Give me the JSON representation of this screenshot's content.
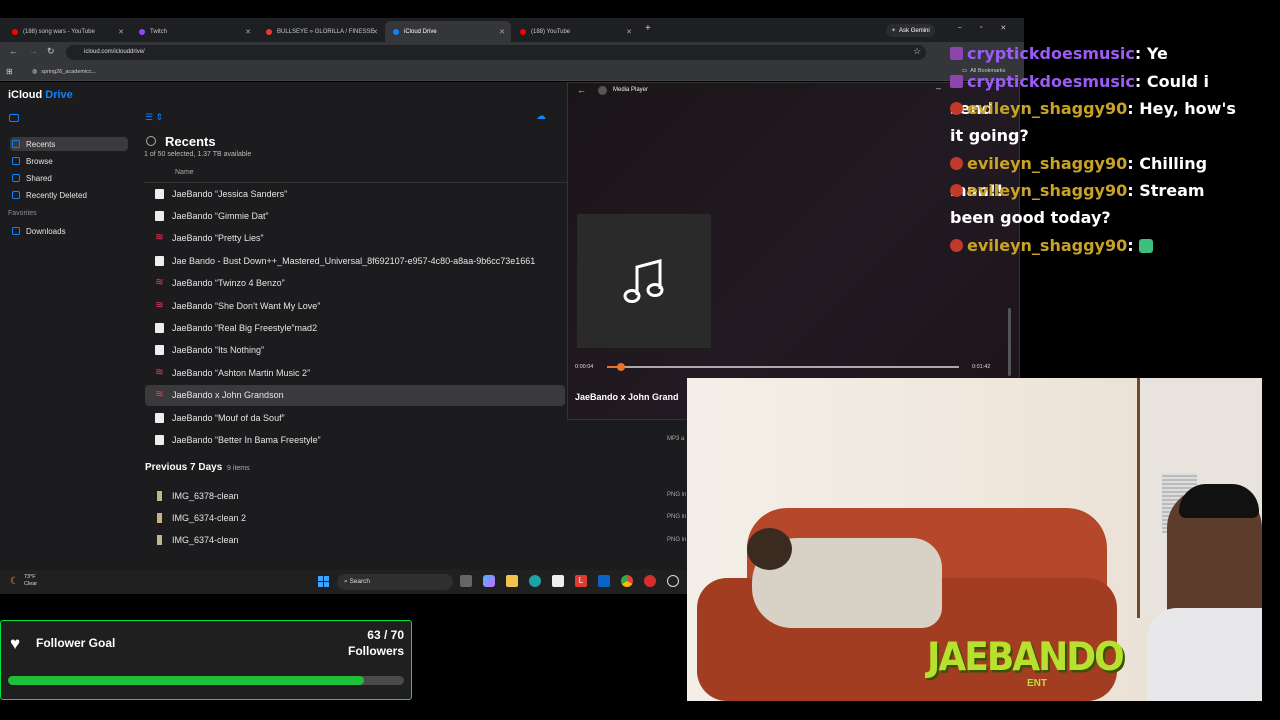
{
  "browser": {
    "tabs": [
      {
        "title": "(188) song wars - YouTube",
        "icon_color": "#ff0000",
        "active": false
      },
      {
        "title": "Twitch",
        "icon_color": "#9146ff",
        "active": false
      },
      {
        "title": "BULLSEYE » GLORILLA / FINESSE",
        "icon_color": "#e53935",
        "active": false
      },
      {
        "title": "iCloud Drive",
        "icon_color": "#0a84ff",
        "active": true
      },
      {
        "title": "(188) YouTube",
        "icon_color": "#ff0000",
        "active": false
      }
    ],
    "ask_gemini": "Ask Gemini",
    "url": "icloud.com/iclouddrive/",
    "bookmark": "spring26_academicc...",
    "all_bookmarks": "All Bookmarks"
  },
  "icloud": {
    "brand": "iCloud",
    "product": "Drive",
    "sidebar": [
      {
        "label": "Recents",
        "selected": true
      },
      {
        "label": "Browse",
        "selected": false
      },
      {
        "label": "Shared",
        "selected": false
      },
      {
        "label": "Recently Deleted",
        "selected": false
      }
    ],
    "favorites_label": "Favorites",
    "favorites": [
      {
        "label": "Downloads"
      }
    ],
    "title": "Recents",
    "subtitle": "1 of 50 selected, 1.37 TB available",
    "name_header": "Name",
    "files": [
      {
        "name": "JaeBando “Jessica Sanders”",
        "type": "doc"
      },
      {
        "name": "JaeBando “Gimmie Dat”",
        "type": "doc"
      },
      {
        "name": "JaeBando “Pretty Lies”",
        "type": "audio"
      },
      {
        "name": "Jae Bando - Bust Down++_Mastered_Universal_8f692107-e957-4c80-a8aa-9b6cc73e1661",
        "type": "doc"
      },
      {
        "name": "JaeBando “Twinzo 4 Benzo”",
        "type": "audio"
      },
      {
        "name": "JaeBando “She Don’t Want My Love”",
        "type": "audio"
      },
      {
        "name": "JaeBando “Real Big Freestyle”mad2",
        "type": "doc"
      },
      {
        "name": "JaeBando “Its Nothing”",
        "type": "doc"
      },
      {
        "name": "JaeBando “Ashton Martin Music 2”",
        "type": "audio"
      },
      {
        "name": "JaeBando x John Grandson",
        "type": "audio",
        "selected": true
      },
      {
        "name": "JaeBando “Mouf of da Souf”",
        "type": "doc"
      },
      {
        "name": "JaeBando “Better In Bama Freestyle”",
        "type": "doc",
        "kind": "MP3 a"
      }
    ],
    "section2_title": "Previous 7 Days",
    "section2_count": "9 items",
    "files2": [
      {
        "name": "IMG_6378-clean",
        "kind": "PNG in"
      },
      {
        "name": "IMG_6374-clean 2",
        "kind": "PNG in"
      },
      {
        "name": "IMG_6374-clean",
        "kind": "PNG in"
      }
    ]
  },
  "media_player": {
    "title": "Media Player",
    "elapsed": "0:00:04",
    "duration": "0:01:42",
    "progress": 0.039,
    "track": "JaeBando x John Grand"
  },
  "taskbar": {
    "weather_temp": "73°F",
    "weather_cond": "Clear",
    "search": "Search"
  },
  "chat": [
    {
      "user": "cryptickdoesmusic",
      "message": "Ye",
      "color": "#9b5cf6"
    },
    {
      "user": "cryptickdoesmusic",
      "message": "Could i send",
      "color": "#9b5cf6"
    },
    {
      "user": "evileyn_shaggy90",
      "message": "Hey, how's it going?",
      "color": "#c9a227"
    },
    {
      "user": "evileyn_shaggy90",
      "message": "Chilling man!!",
      "color": "#c9a227"
    },
    {
      "user": "evileyn_shaggy90",
      "message": "Stream been good today?",
      "color": "#c9a227"
    },
    {
      "user": "evileyn_shaggy90",
      "message": "",
      "color": "#c9a227"
    }
  ],
  "follower_goal": {
    "label": "Follower Goal",
    "current": 63,
    "target": 70,
    "count_text": "63 / 70",
    "unit": "Followers"
  },
  "webcam": {
    "logo_text": "JAEBANDO",
    "logo_sub": "ENT"
  }
}
